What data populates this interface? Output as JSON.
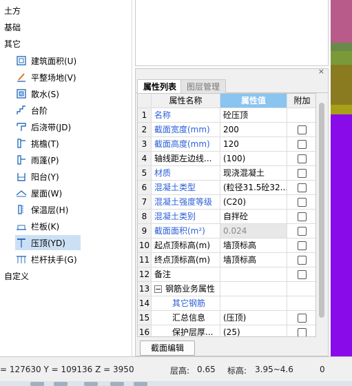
{
  "tree": {
    "categories": [
      "土方",
      "基础",
      "其它"
    ],
    "items": [
      {
        "label": "建筑面积(U)",
        "icon": "area-icon"
      },
      {
        "label": "平整场地(V)",
        "icon": "level-site-icon"
      },
      {
        "label": "散水(S)",
        "icon": "apron-icon"
      },
      {
        "label": "台阶",
        "icon": "steps-icon"
      },
      {
        "label": "后浇带(JD)",
        "icon": "post-cast-strip-icon"
      },
      {
        "label": "挑檐(T)",
        "icon": "eave-icon"
      },
      {
        "label": "雨蓬(P)",
        "icon": "canopy-icon"
      },
      {
        "label": "阳台(Y)",
        "icon": "balcony-icon"
      },
      {
        "label": "屋面(W)",
        "icon": "roof-icon"
      },
      {
        "label": "保温层(H)",
        "icon": "insulation-icon"
      },
      {
        "label": "栏板(K)",
        "icon": "parapet-icon"
      },
      {
        "label": "压顶(YD)",
        "icon": "coping-icon",
        "selected": true
      },
      {
        "label": "栏杆扶手(G)",
        "icon": "railing-icon"
      }
    ],
    "footer_category": "自定义"
  },
  "panel": {
    "close_label": "×",
    "tabs": {
      "active": "属性列表",
      "inactive": "图层管理"
    },
    "headers": {
      "name": "属性名称",
      "value": "属性值",
      "add": "附加"
    },
    "rows": [
      {
        "no": "1",
        "name": "名称",
        "value": "砼压顶",
        "blue": true,
        "check": false
      },
      {
        "no": "2",
        "name": "截面宽度(mm)",
        "value": "200",
        "blue": true,
        "check": true
      },
      {
        "no": "3",
        "name": "截面高度(mm)",
        "value": "120",
        "blue": true,
        "check": true
      },
      {
        "no": "4",
        "name": "轴线距左边线...",
        "value": "(100)",
        "blue": false,
        "check": true
      },
      {
        "no": "5",
        "name": "材质",
        "value": "现浇混凝土",
        "blue": true,
        "check": true
      },
      {
        "no": "6",
        "name": "混凝土类型",
        "value": "(粒径31.5砼32....",
        "blue": true,
        "check": true
      },
      {
        "no": "7",
        "name": "混凝土强度等级",
        "value": "(C20)",
        "blue": true,
        "check": true
      },
      {
        "no": "8",
        "name": "混凝土类别",
        "value": "自拌砼",
        "blue": true,
        "check": true
      },
      {
        "no": "9",
        "name": "截面面积(m²)",
        "value": "0.024",
        "blue": true,
        "check": true,
        "disabled": true
      },
      {
        "no": "10",
        "name": "起点顶标高(m)",
        "value": "墙顶标高",
        "blue": false,
        "check": true
      },
      {
        "no": "11",
        "name": "终点顶标高(m)",
        "value": "墙顶标高",
        "blue": false,
        "check": true
      },
      {
        "no": "12",
        "name": "备注",
        "value": "",
        "blue": false,
        "check": true
      },
      {
        "no": "13",
        "name": "钢筋业务属性",
        "value": "",
        "blue": false,
        "check": false,
        "group": true,
        "expander": "−"
      },
      {
        "no": "14",
        "name": "其它钢筋",
        "value": "",
        "blue": true,
        "check": false,
        "child": true
      },
      {
        "no": "15",
        "name": "汇总信息",
        "value": "(压顶)",
        "blue": false,
        "check": true,
        "child": true
      },
      {
        "no": "16",
        "name": "保护层厚...",
        "value": "(25)",
        "blue": false,
        "check": true,
        "child": true
      }
    ],
    "edit_button": "截面编辑"
  },
  "status": {
    "coords": "= 127630 Y = 109136 Z = 3950",
    "floor_height_label": "层高:",
    "floor_height_value": "0.65",
    "elevation_label": "标高:",
    "elevation_value": "3.95~4.6",
    "extra_value": "0"
  },
  "colors": {
    "accent_header": "#8ac4f0",
    "blue_text": "#2b5fd9",
    "selection": "#cce0f5",
    "viewport_bands": [
      "#b85a8a",
      "#6a8a4a",
      "#7a9a3a",
      "#8a7a20",
      "#a8a018",
      "#8a0bea"
    ]
  }
}
